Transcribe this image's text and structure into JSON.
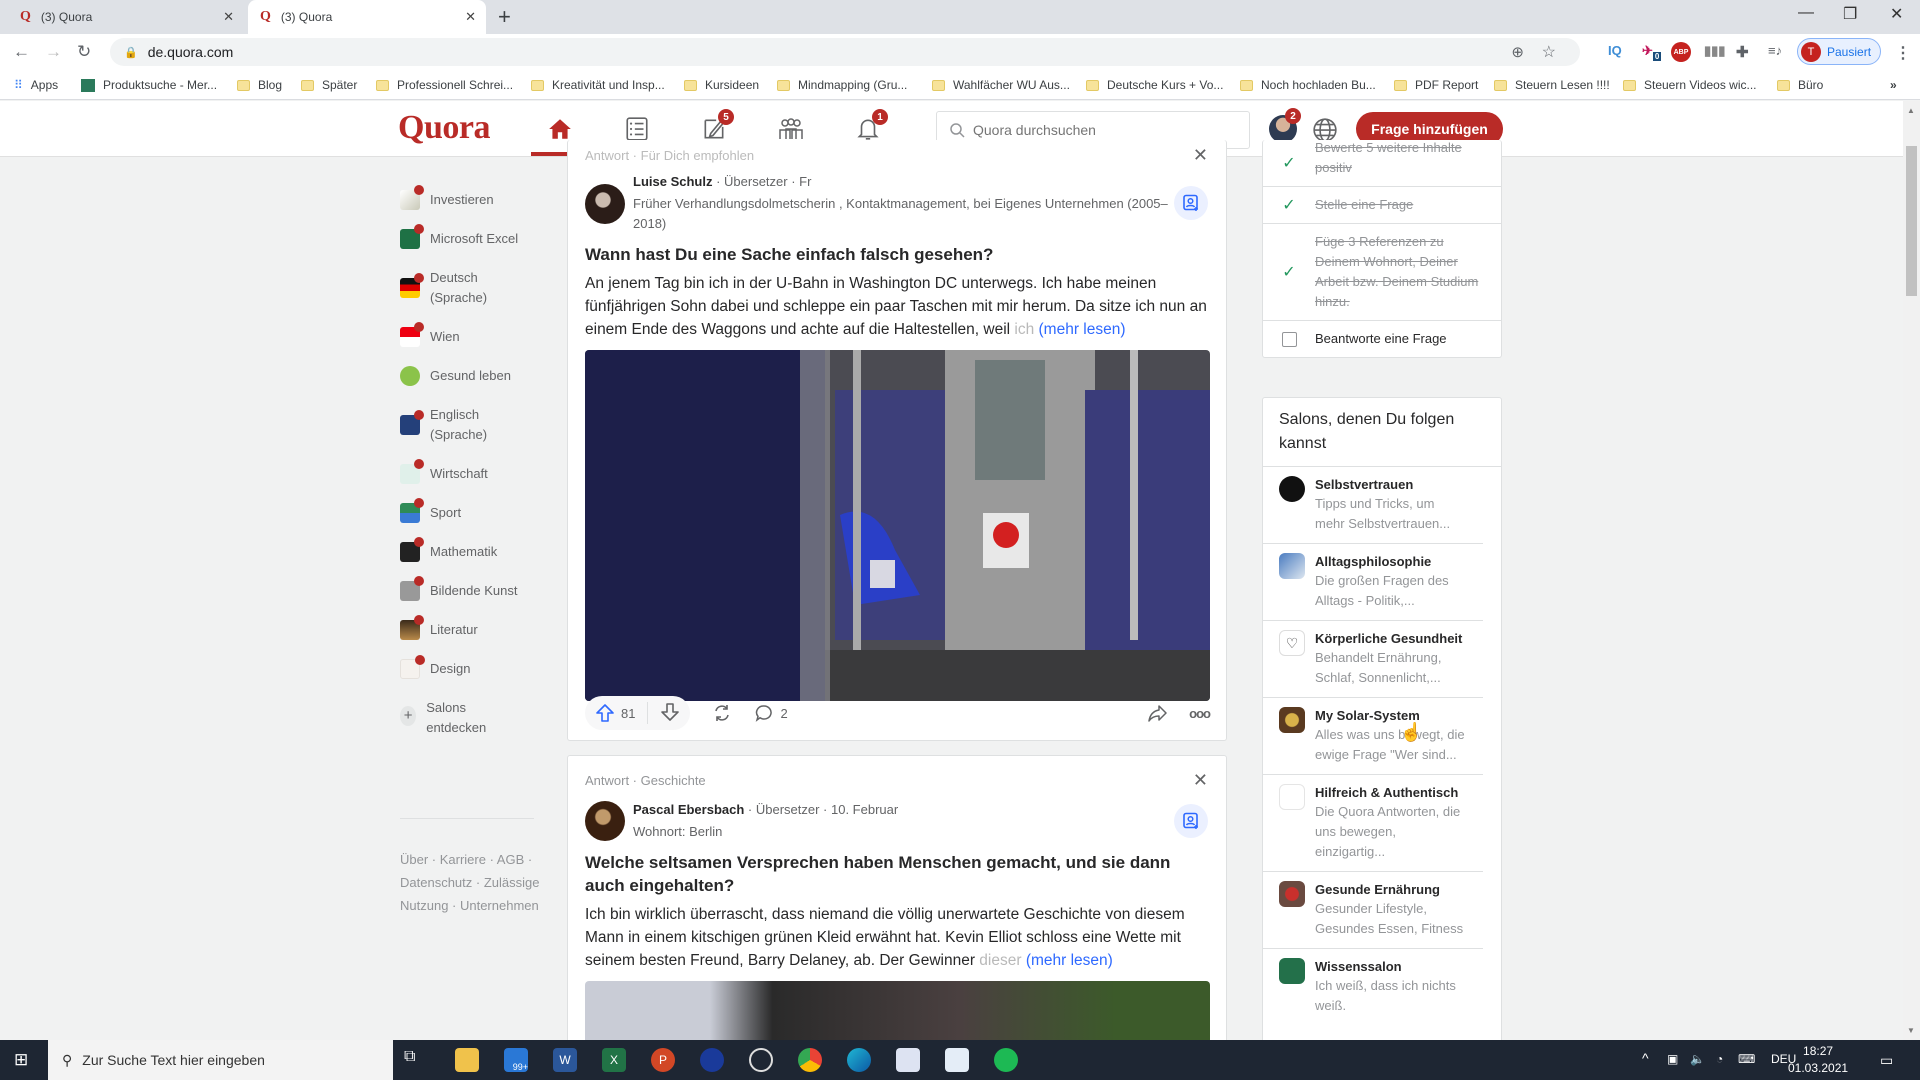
{
  "browser": {
    "tabs": [
      {
        "title": "(3) Quora",
        "active": false
      },
      {
        "title": "(3) Quora",
        "active": true
      }
    ],
    "url": "de.quora.com",
    "profile_label": "Pausiert",
    "profile_initial": "T",
    "ext_badge": "0",
    "bookmarks": [
      "Apps",
      "Produktsuche - Mer...",
      "Blog",
      "Später",
      "Professionell Schrei...",
      "Kreativität und Insp...",
      "Kursideen",
      "Mindmapping  (Gru...",
      "Wahlfächer WU Aus...",
      "Deutsche Kurs + Vo...",
      "Noch hochladen Bu...",
      "PDF Report",
      "Steuern Lesen !!!!",
      "Steuern Videos wic...",
      "Büro"
    ]
  },
  "header": {
    "logo": "Quora",
    "answer_badge": "5",
    "notif_badge": "1",
    "profile_badge": "2",
    "search_placeholder": "Quora durchsuchen",
    "add_question": "Frage hinzufügen",
    "accent": "#b92b27"
  },
  "left_nav": {
    "items": [
      {
        "label": "Investieren",
        "dot": true
      },
      {
        "label": "Microsoft Excel",
        "dot": true
      },
      {
        "label": "Deutsch (Sprache)",
        "dot": true
      },
      {
        "label": "Wien",
        "dot": true
      },
      {
        "label": "Gesund leben",
        "dot": false
      },
      {
        "label": "Englisch (Sprache)",
        "dot": true
      },
      {
        "label": "Wirtschaft",
        "dot": true
      },
      {
        "label": "Sport",
        "dot": true
      },
      {
        "label": "Mathematik",
        "dot": true
      },
      {
        "label": "Bildende Kunst",
        "dot": true
      },
      {
        "label": "Literatur",
        "dot": true
      },
      {
        "label": "Design",
        "dot": true
      }
    ],
    "discover": "Salons entdecken",
    "footer": "Über · Karriere · AGB · Datenschutz · Zulässige Nutzung · Unternehmen"
  },
  "feed": [
    {
      "context": "Antwort · Für Dich empfohlen",
      "author": "Luise Schulz",
      "author_meta": " · Übersetzer · Fr",
      "credential": "Früher Verhandlungsdolmetscherin , Kontaktmanagement, bei Eigenes Unternehmen (2005–2018)",
      "question": "Wann hast Du eine Sache einfach falsch gesehen?",
      "text": "An jenem Tag bin ich in der U-Bahn in Washington DC unterwegs. Ich habe meinen fünfjährigen Sohn dabei und schleppe ein paar Taschen mit mir herum. Da sitze ich nun an einem Ende des Waggons und achte auf die Haltestellen, weil",
      "text_fade": " ich",
      "more": "(mehr lesen)",
      "upvotes": "81",
      "comments": "2"
    },
    {
      "context": "Antwort · Geschichte",
      "author": "Pascal Ebersbach",
      "author_meta": " · Übersetzer · 10. Februar",
      "credential": "Wohnort: Berlin",
      "question": "Welche seltsamen Versprechen haben Menschen gemacht, und sie dann auch eingehalten?",
      "text": "Ich bin wirklich überrascht, dass niemand die völlig unerwartete Geschichte von diesem Mann in einem kitschigen grünen Kleid erwähnt hat. Kevin Elliot schloss eine Wette mit seinem besten Freund, Barry Delaney, ab. Der Gewinner",
      "text_fade": " dieser",
      "more": "(mehr lesen)"
    }
  ],
  "tasks": [
    {
      "label": "Bewerte 5 weitere Inhalte positiv",
      "done": true
    },
    {
      "label": "Stelle eine Frage",
      "done": true
    },
    {
      "label": "Füge 3 Referenzen zu Deinem Wohnort, Deiner Arbeit bzw. Deinem Studium hinzu.",
      "done": true
    },
    {
      "label": "Beantworte eine Frage",
      "done": false
    }
  ],
  "salons": {
    "title": "Salons, denen Du folgen kannst",
    "items": [
      {
        "name": "Selbstvertrauen",
        "desc": "Tipps und Tricks, um mehr Selbstvertrauen..."
      },
      {
        "name": "Alltagsphilosophie",
        "desc": "Die großen Fragen des Alltags - Politik,..."
      },
      {
        "name": "Körperliche Gesundheit",
        "desc": "Behandelt Ernährung, Schlaf, Sonnenlicht,..."
      },
      {
        "name": "My Solar-System",
        "desc": "Alles was uns bewegt, die ewige Frage \"Wer sind..."
      },
      {
        "name": "Hilfreich & Authentisch",
        "desc": "Die Quora Antworten, die uns bewegen, einzigartig..."
      },
      {
        "name": "Gesunde Ernährung",
        "desc": "Gesunder Lifestyle, Gesundes Essen, Fitness"
      },
      {
        "name": "Wissenssalon",
        "desc": "Ich weiß, dass ich nichts weiß."
      }
    ]
  },
  "taskbar": {
    "search_placeholder": "Zur Suche Text hier eingeben",
    "mail_badge": "99+",
    "lang": "DEU",
    "time": "18:27",
    "date": "01.03.2021"
  }
}
